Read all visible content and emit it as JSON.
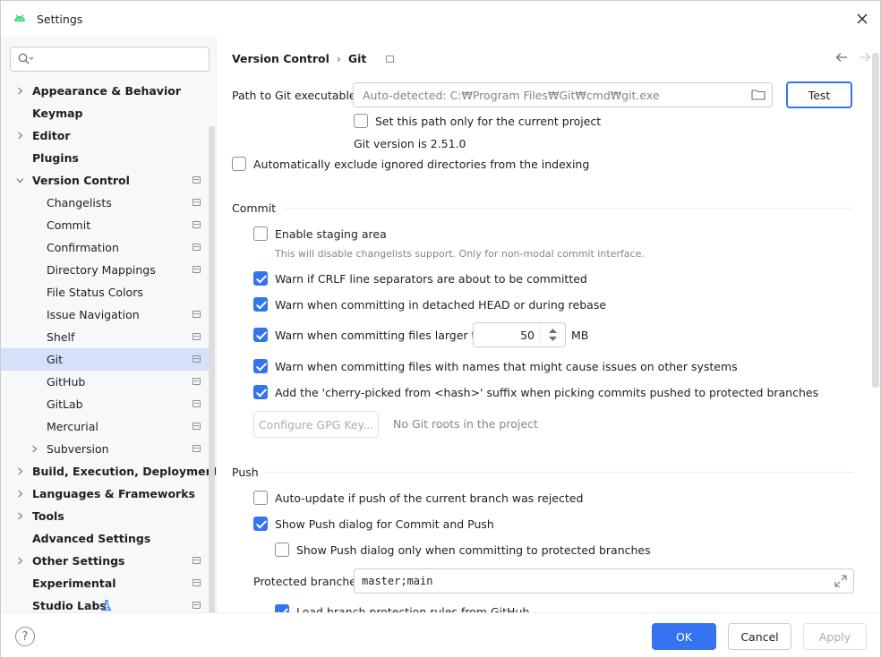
{
  "window": {
    "title": "Settings"
  },
  "search": {
    "placeholder": ""
  },
  "sidebar": {
    "items": [
      {
        "label": "Appearance & Behavior"
      },
      {
        "label": "Keymap"
      },
      {
        "label": "Editor"
      },
      {
        "label": "Plugins"
      },
      {
        "label": "Version Control"
      },
      {
        "label": "Changelists"
      },
      {
        "label": "Commit"
      },
      {
        "label": "Confirmation"
      },
      {
        "label": "Directory Mappings"
      },
      {
        "label": "File Status Colors"
      },
      {
        "label": "Issue Navigation"
      },
      {
        "label": "Shelf"
      },
      {
        "label": "Git"
      },
      {
        "label": "GitHub"
      },
      {
        "label": "GitLab"
      },
      {
        "label": "Mercurial"
      },
      {
        "label": "Subversion"
      },
      {
        "label": "Build, Execution, Deployment"
      },
      {
        "label": "Languages & Frameworks"
      },
      {
        "label": "Tools"
      },
      {
        "label": "Advanced Settings"
      },
      {
        "label": "Other Settings"
      },
      {
        "label": "Experimental"
      },
      {
        "label": "Studio Labs"
      }
    ]
  },
  "breadcrumb": {
    "parent": "Version Control",
    "separator": "›",
    "current": "Git"
  },
  "git": {
    "path_label": "Path to Git executable:",
    "path_placeholder": "Auto-detected: C:₩Program Files₩Git₩cmd₩git.exe",
    "test_button": "Test",
    "project_only_label": "Set this path only for the current project",
    "version_text": "Git version is 2.51.0",
    "exclude_ignored_label": "Automatically exclude ignored directories from the indexing"
  },
  "commit": {
    "section_title": "Commit",
    "staging_label": "Enable staging area",
    "staging_hint": "This will disable changelists support. Only for non-modal commit interface.",
    "crlf_label": "Warn if CRLF line separators are about to be committed",
    "detached_label": "Warn when committing in detached HEAD or during rebase",
    "large_files_label": "Warn when committing files larger than",
    "large_files_value": "50",
    "large_files_unit": "MB",
    "names_label": "Warn when committing files with names that might cause issues on other systems",
    "cherry_label": "Add the 'cherry-picked from <hash>' suffix when picking commits pushed to protected branches",
    "gpg_button": "Configure GPG Key...",
    "gpg_status": "No Git roots in the project"
  },
  "push": {
    "section_title": "Push",
    "auto_update_label": "Auto-update if push of the current branch was rejected",
    "show_dialog_label": "Show Push dialog for Commit and Push",
    "protected_only_label": "Show Push dialog only when committing to protected branches",
    "protected_label": "Protected branches:",
    "protected_value": "master;main",
    "load_rules_label": "Load branch protection rules from GitHub"
  },
  "footer": {
    "help": "?",
    "ok": "OK",
    "cancel": "Cancel",
    "apply": "Apply"
  }
}
